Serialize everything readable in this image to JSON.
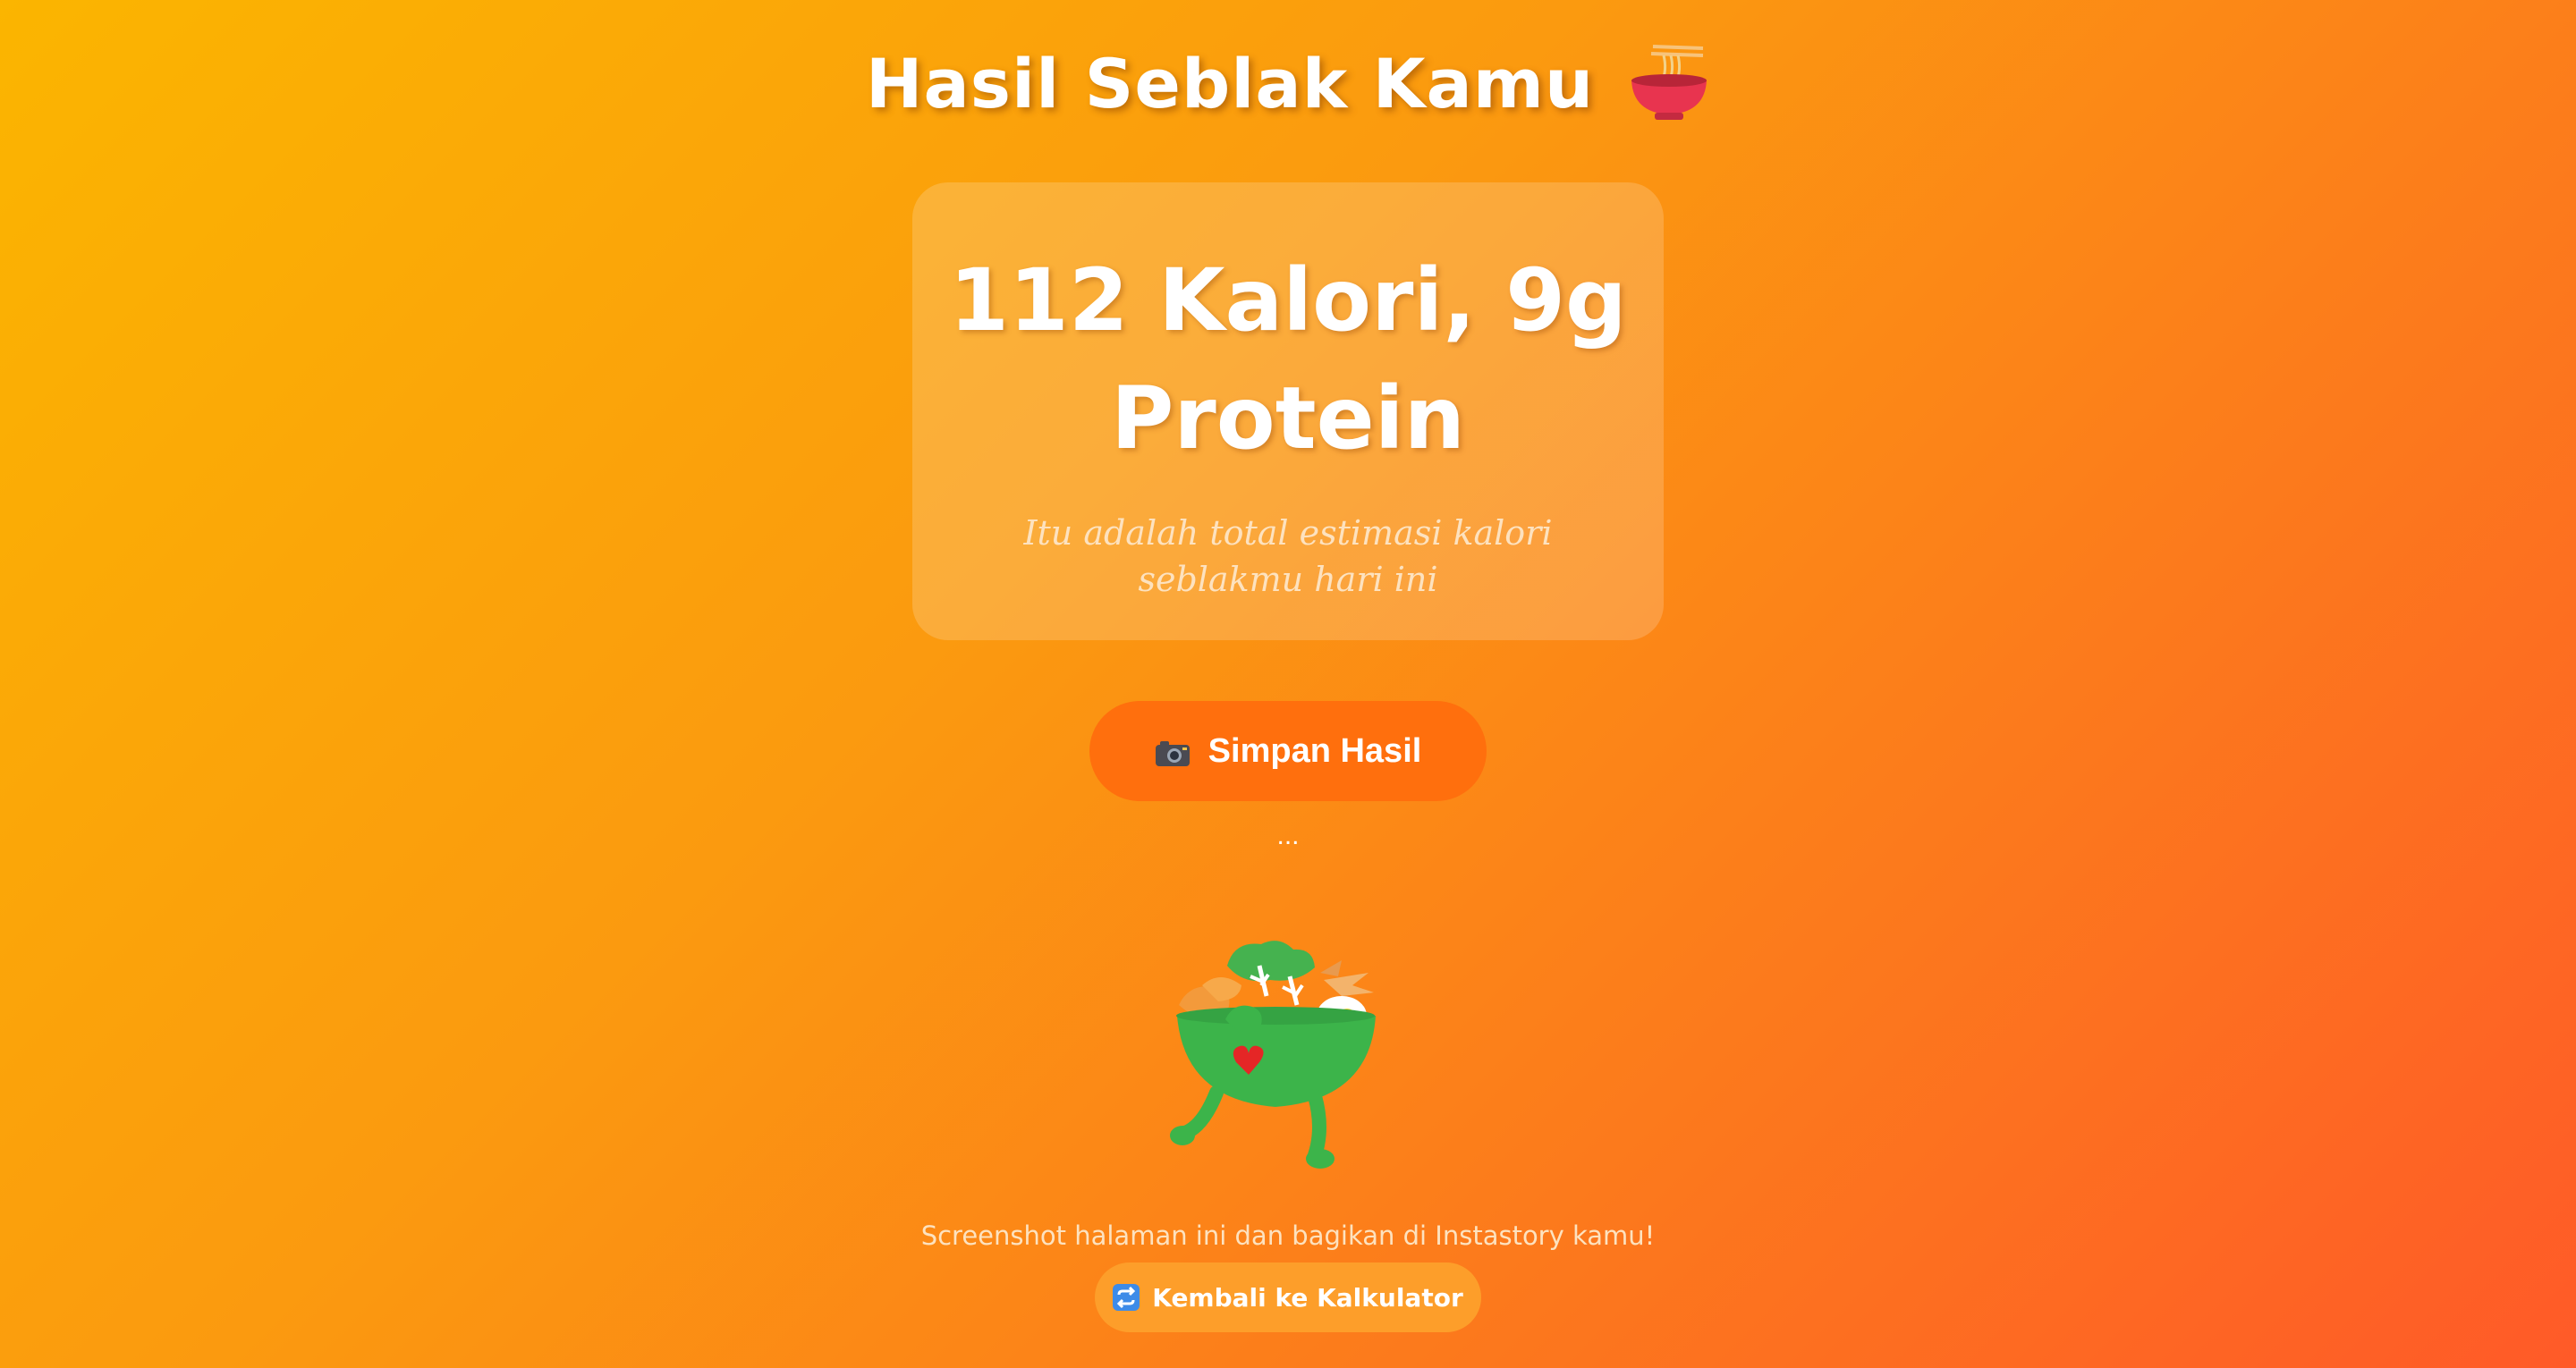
{
  "page": {
    "title": "Hasil Seblak Kamu",
    "title_icon": "noodle-bowl-icon"
  },
  "result_card": {
    "headline": "112 Kalori, 9g Protein",
    "calories": 112,
    "protein_g": 9,
    "subtitle": "Itu adalah total estimasi kalori seblakmu hari ini"
  },
  "actions": {
    "save_label": "Simpan Hasil",
    "save_icon": "camera-icon",
    "status": "...",
    "back_label": "Kembali ke Kalkulator",
    "back_icon": "repeat-icon"
  },
  "share": {
    "text": "Screenshot halaman ini dan bagikan di Instastory kamu!",
    "illustration": "seblak-bowl-mascot"
  },
  "colors": {
    "gradient_start": "#fbb500",
    "gradient_end": "#ff5a28",
    "save_button": "#ff6f0d",
    "back_button": "#fd9e2a",
    "bowl_green": "#3cb44a"
  }
}
